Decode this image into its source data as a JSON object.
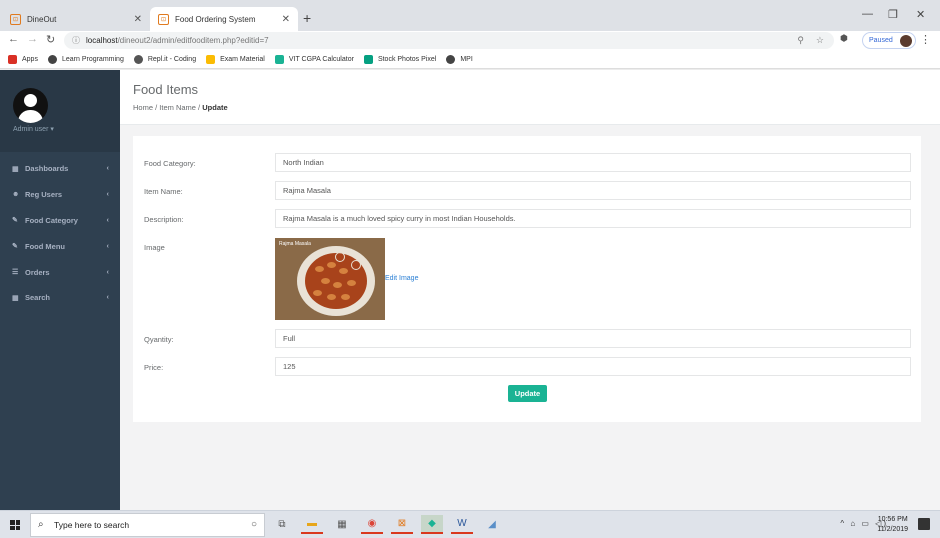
{
  "browser": {
    "tabs": [
      {
        "label": "DineOut"
      },
      {
        "label": "Food Ordering System"
      }
    ],
    "url_host": "localhost",
    "url_path": "/dineout2/admin/editfooditem.php?editid=7",
    "profile_status": "Paused",
    "bookmarks": [
      {
        "label": "Apps",
        "color": "#d93025"
      },
      {
        "label": "Learn Programming",
        "color": "#444444"
      },
      {
        "label": "Repl.it - Coding",
        "color": "#555555"
      },
      {
        "label": "Exam Material",
        "color": "#fbbc04"
      },
      {
        "label": "VIT CGPA Calculator",
        "color": "#1ab394"
      },
      {
        "label": "Stock Photos Pixel",
        "color": "#05a081"
      },
      {
        "label": "MPI",
        "color": "#444444"
      }
    ]
  },
  "sidebar": {
    "user_label": "Admin user ▾",
    "items": [
      {
        "label": "Dashboards",
        "icon": "grid-icon"
      },
      {
        "label": "Reg Users",
        "icon": "users-icon"
      },
      {
        "label": "Food Category",
        "icon": "edit-icon"
      },
      {
        "label": "Food Menu",
        "icon": "edit-icon"
      },
      {
        "label": "Orders",
        "icon": "list-icon"
      },
      {
        "label": "Search",
        "icon": "grid-icon"
      }
    ]
  },
  "page": {
    "title": "Food Items",
    "breadcrumb": [
      "Home",
      "Item Name",
      "Update"
    ]
  },
  "form": {
    "category_label": "Food Category:",
    "category_value": "North Indian",
    "name_label": "Item Name:",
    "name_value": "Rajma Masala",
    "description_label": "Description:",
    "description_value": "Rajma Masala is a much loved spicy curry in most Indian Households.",
    "image_label": "Image",
    "image_caption": "Rajma Masala",
    "edit_image_label": "Edit Image",
    "quantity_label": "Qyantity:",
    "quantity_value": "Full",
    "price_label": "Price:",
    "price_value": "125",
    "submit_label": "Update"
  },
  "taskbar": {
    "search_placeholder": "Type here to search",
    "time": "10:56 PM",
    "date": "11/2/2019"
  }
}
